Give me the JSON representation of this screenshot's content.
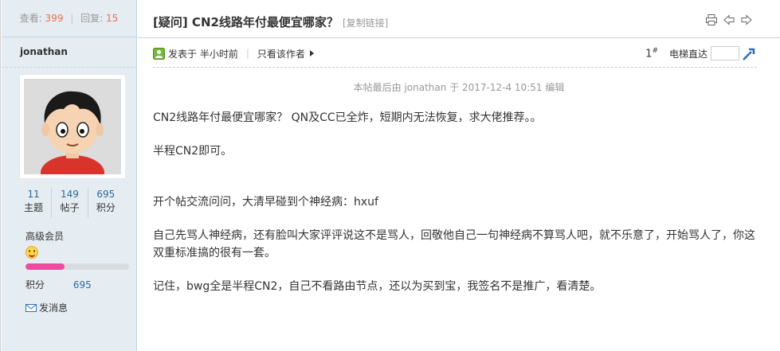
{
  "stats": {
    "views_label": "查看:",
    "views": "399",
    "sep": "|",
    "replies_label": "回复:",
    "replies": "15"
  },
  "author": {
    "username": "jonathan",
    "threads": "11",
    "threads_label": "主题",
    "posts": "149",
    "posts_label": "帖子",
    "credits": "695",
    "credits_label": "积分",
    "group": "高级会员",
    "level_progress": 0.38,
    "credit_label": "积分",
    "credit_value": "695",
    "message_label": "发消息"
  },
  "thread": {
    "title": "[疑问] CN2线路年付最便宜哪家？",
    "copy_link": "[复制链接]"
  },
  "meta": {
    "posted": "发表于 半小时前",
    "sep": "|",
    "only_author": "只看该作者",
    "floor": "1",
    "floor_suffix": "#",
    "lift_label": "电梯直达"
  },
  "post": {
    "edited_note": "本帖最后由 jonathan 于 2017-12-4 10:51 编辑",
    "paragraphs": [
      "CN2线路年付最便宜哪家？  QN及CC已全炸，短期内无法恢复，求大佬推荐。。",
      "半程CN2即可。",
      "开个帖交流问问，大清早碰到个神经病：hxuf",
      "自己先骂人神经病，还有脸叫大家评评说这不是骂人，回敬他自己一句神经病不算骂人吧，就不乐意了，开始骂人了，你这双重标准搞的很有一套。",
      "记住，bwg全是半程CN2，自己不看路由节点，还以为买到宝，我签名不是推广，看清楚。"
    ]
  },
  "colors": {
    "accent_blue": "#336699",
    "count_red": "#f26c4f",
    "progress": "#ea4ca0",
    "side_bg": "#e5edf2"
  },
  "icons": [
    "print-icon",
    "prev-arrow-icon",
    "next-arrow-icon",
    "online-status-icon",
    "envelope-icon",
    "go-arrow-icon",
    "smiley-level-icon"
  ]
}
